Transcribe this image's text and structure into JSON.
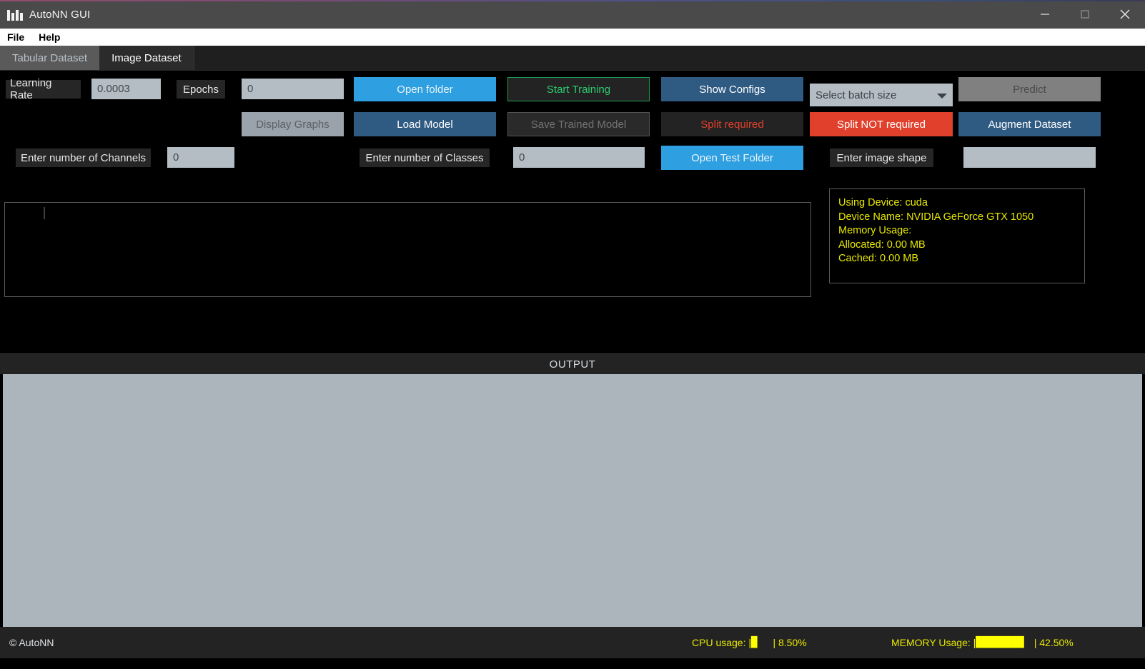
{
  "window": {
    "title": "AutoNN GUI",
    "logo_icon": "nn-logo-icon",
    "minimize_icon": "minimize-icon",
    "maximize_icon": "maximize-icon",
    "close_icon": "close-icon"
  },
  "menubar": {
    "items": [
      "File",
      "Help"
    ]
  },
  "tabs": [
    {
      "label": "Tabular Dataset",
      "active": false
    },
    {
      "label": "Image Dataset",
      "active": true
    }
  ],
  "controls": {
    "learning_rate_label": "Learning Rate",
    "learning_rate_value": "0.0003",
    "epochs_label": "Epochs",
    "epochs_value": "0",
    "open_folder": "Open folder",
    "start_training": "Start Training",
    "show_configs": "Show Configs",
    "batch_size_selected": "Select batch size",
    "predict": "Predict",
    "display_graphs": "Display Graphs",
    "load_model": "Load Model",
    "save_trained_model": "Save Trained Model",
    "split_required": "Split required",
    "split_not_required": "Split NOT required",
    "augment_dataset": "Augment Dataset",
    "channels_label": "Enter number of Channels",
    "channels_value": "0",
    "classes_label": "Enter number of Classes",
    "classes_value": "0",
    "open_test_folder": "Open Test Folder",
    "image_shape_label": "Enter image shape",
    "image_shape_value": ""
  },
  "device_panel": {
    "lines": [
      "Using Device: cuda",
      "Device Name: NVIDIA GeForce GTX 1050",
      "Memory Usage:",
      "Allocated: 0.00 MB",
      "Cached: 0.00 MB"
    ]
  },
  "output": {
    "header": "OUTPUT",
    "content": ""
  },
  "statusbar": {
    "copyright": "© AutoNN",
    "cpu_label": "CPU usage: |",
    "cpu_bar": "█",
    "cpu_percent": "| 8.50%",
    "memory_label": "MEMORY Usage: |",
    "memory_bar": "████████",
    "memory_percent": "| 42.50%"
  },
  "colors": {
    "accent_blue": "#2e9fe0",
    "steel_blue": "#2f5a82",
    "danger_red": "#e0402c",
    "success_green": "#2ecc71",
    "yellow": "#e8e800",
    "panel_gray": "#acb4bc"
  }
}
